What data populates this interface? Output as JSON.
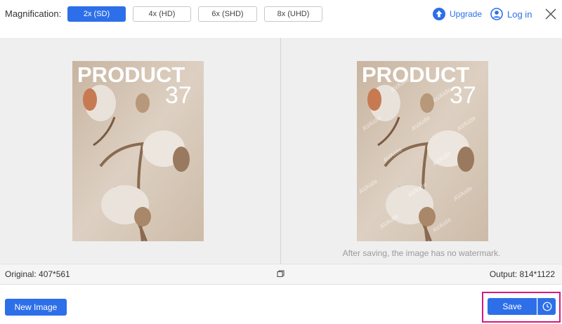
{
  "header": {
    "magnification_label": "Magnification:",
    "options": [
      {
        "label": "2x (SD)",
        "active": true
      },
      {
        "label": "4x (HD)",
        "active": false
      },
      {
        "label": "6x (SHD)",
        "active": false
      },
      {
        "label": "8x (UHD)",
        "active": false
      }
    ],
    "upgrade_label": "Upgrade",
    "login_label": "Log in",
    "upgrade_icon": "upgrade-arrow-icon",
    "login_icon": "user-icon",
    "close_icon": "close-icon"
  },
  "preview": {
    "left_image": {
      "line1": "PRODUCT",
      "line2": "37"
    },
    "right_image": {
      "line1": "PRODUCT",
      "line2": "37",
      "watermark": "AVAide"
    },
    "watermark_note": "After saving, the image has no watermark."
  },
  "info": {
    "original": "Original: 407*561",
    "output": "Output: 814*1122",
    "compare_icon": "compare-icon"
  },
  "footer": {
    "new_image_label": "New Image",
    "save_label": "Save",
    "history_icon": "clock-icon"
  },
  "colors": {
    "accent": "#2d6fe8",
    "highlight": "#d6197f",
    "pane_bg": "#efefef"
  }
}
